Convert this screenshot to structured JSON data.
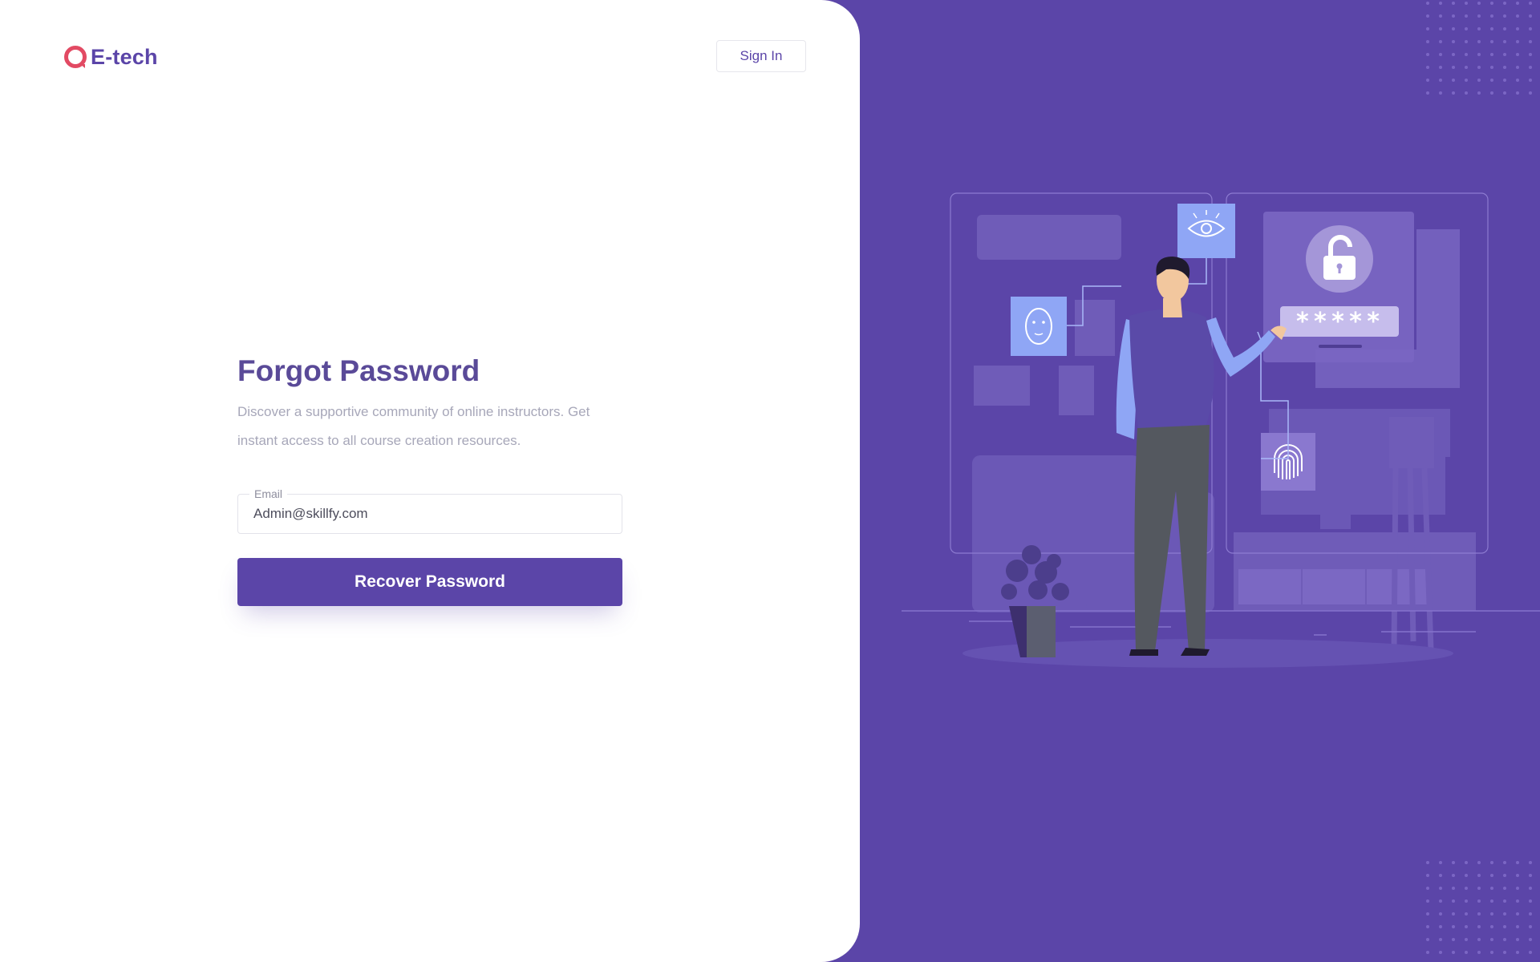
{
  "brand": {
    "name": "E-tech",
    "accent_color": "#5b45a8",
    "logo_color": "#e24a63"
  },
  "header": {
    "signin_label": "Sign In"
  },
  "form": {
    "title": "Forgot Password",
    "description": "Discover a supportive community of online instructors. Get instant access to all course creation resources.",
    "email_label": "Email",
    "email_value": "Admin@skillfy.com",
    "submit_label": "Recover Password"
  },
  "illustration": {
    "password_mask": "*****",
    "icons": [
      "eye-icon",
      "face-id-icon",
      "padlock-icon",
      "fingerprint-icon"
    ]
  }
}
